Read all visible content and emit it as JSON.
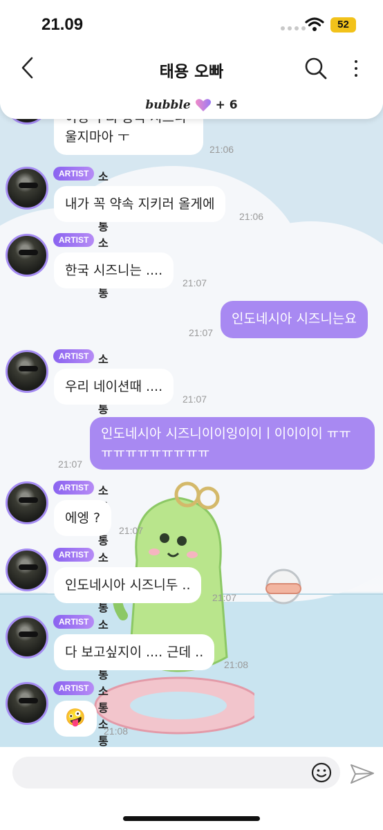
{
  "status": {
    "time": "21.09",
    "battery": "52"
  },
  "header": {
    "title": "태용 오빠",
    "bubble_logo": "bubble",
    "member_count": "+ 6"
  },
  "messages": [
    {
      "type": "received-continued",
      "lines": [
        "이잉 우리 중국 시즈니",
        "울지마아 ㅜ"
      ],
      "time": "21:06"
    },
    {
      "type": "received",
      "badge": "ARTIST",
      "sender": "소통소통",
      "text": "내가 꼭 약속 지키러 올게에",
      "time": "21:06"
    },
    {
      "type": "received",
      "badge": "ARTIST",
      "sender": "소통소통",
      "text": "한국 시즈니는 ....",
      "time": "21:07"
    },
    {
      "type": "sent",
      "text": "인도네시아 시즈니는요",
      "time": "21:07"
    },
    {
      "type": "received",
      "badge": "ARTIST",
      "sender": "소통소통",
      "text": "우리 네이션때 ....",
      "time": "21:07"
    },
    {
      "type": "sent",
      "lines": [
        "인도네시아 시즈니이이잉이이ㅣ이이이이 ㅠㅠ",
        "ㅠㅠㅠㅠㅠㅠㅠㅠㅠ"
      ],
      "time": "21:07"
    },
    {
      "type": "received",
      "badge": "ARTIST",
      "sender": "소통소통",
      "text": "에엥 ?",
      "time": "21:07"
    },
    {
      "type": "received",
      "badge": "ARTIST",
      "sender": "소통소통",
      "text": "인도네시아 시즈니두 ..",
      "time": "21:07"
    },
    {
      "type": "received",
      "badge": "ARTIST",
      "sender": "소통소통",
      "text": "다 보고싶지이 .... 근데 ..",
      "time": "21:08"
    },
    {
      "type": "received",
      "badge": "ARTIST",
      "sender": "소통소통",
      "text": "🤪",
      "time": "21:08"
    }
  ],
  "composer": {
    "placeholder": ""
  },
  "icons": {
    "back": "chevron-left-icon",
    "search": "search-icon",
    "more": "more-vertical-icon",
    "emoji": "smiley-icon",
    "send": "send-icon",
    "heart": "heart-icon"
  },
  "colors": {
    "accent": "#a889f2",
    "badge": "#8a63f0",
    "battery": "#f2c21a"
  }
}
